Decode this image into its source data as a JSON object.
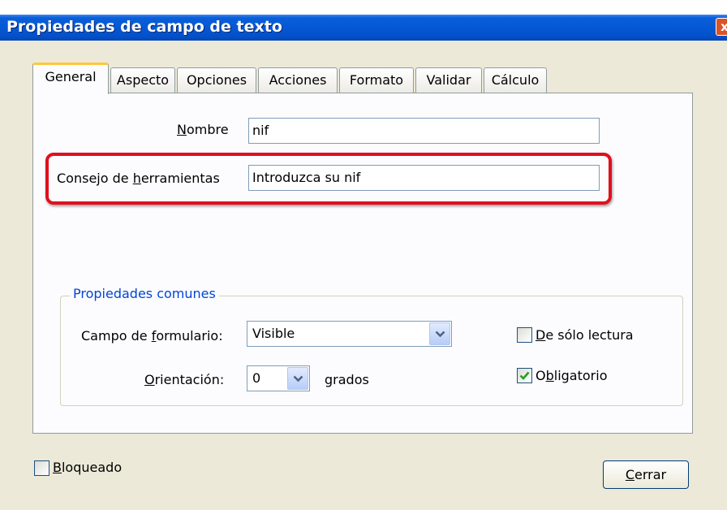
{
  "window": {
    "title": "Propiedades de campo de texto",
    "close_glyph": "x"
  },
  "tabs": [
    {
      "label": "General",
      "active": true
    },
    {
      "label": "Aspecto",
      "active": false
    },
    {
      "label": "Opciones",
      "active": false
    },
    {
      "label": "Acciones",
      "active": false
    },
    {
      "label": "Formato",
      "active": false
    },
    {
      "label": "Validar",
      "active": false
    },
    {
      "label": "Cálculo",
      "active": false
    }
  ],
  "general": {
    "nombre_label_pre": "",
    "nombre_label_ul": "N",
    "nombre_label_post": "ombre",
    "nombre_value": "nif",
    "tooltip_label_pre": "Consejo de ",
    "tooltip_label_ul": "h",
    "tooltip_label_post": "erramientas",
    "tooltip_value": "Introduzca su nif"
  },
  "common": {
    "title": "Propiedades comunes",
    "form_field_label_pre": "Campo de ",
    "form_field_label_ul": "f",
    "form_field_label_post": "ormulario:",
    "form_field_value": "Visible",
    "orientation_label_pre": "",
    "orientation_label_ul": "O",
    "orientation_label_post": "rientación:",
    "orientation_value": "0",
    "degrees_label": "grados",
    "readonly_label_pre": "",
    "readonly_label_ul": "D",
    "readonly_label_post": "e sólo lectura",
    "readonly_checked": false,
    "required_label_pre": "O",
    "required_label_ul": "b",
    "required_label_post": "ligatorio",
    "required_checked": true
  },
  "footer": {
    "locked_label_pre": "",
    "locked_label_ul": "B",
    "locked_label_post": "loqueado",
    "locked_checked": false,
    "close_label_pre": "",
    "close_label_ul": "C",
    "close_label_post": "errar"
  },
  "colors": {
    "titlebar": "#0558d6",
    "highlight": "#e0101e",
    "group_title": "#0046d5",
    "check": "#21a121"
  }
}
